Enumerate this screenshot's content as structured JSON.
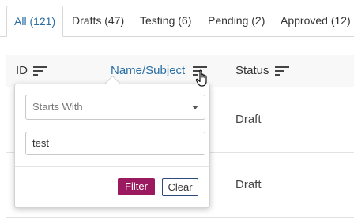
{
  "tabs": [
    {
      "label": "All (121)",
      "active": true
    },
    {
      "label": "Drafts (47)",
      "active": false
    },
    {
      "label": "Testing (6)",
      "active": false
    },
    {
      "label": "Pending (2)",
      "active": false
    },
    {
      "label": "Approved (12)",
      "active": false
    }
  ],
  "table": {
    "columns": [
      {
        "label": "ID",
        "icon": "sort-lines-icon"
      },
      {
        "label": "Name/Subject",
        "icon": "sort-lines-icon",
        "highlighted": true
      },
      {
        "label": "Status",
        "icon": "sort-lines-icon"
      }
    ],
    "rows": [
      {
        "status": "Draft"
      },
      {
        "status": "Draft"
      }
    ]
  },
  "filter_popup": {
    "match_mode": "Starts With",
    "value": "test",
    "filter_label": "Filter",
    "clear_label": "Clear"
  },
  "colors": {
    "accent": "#2b6ea4",
    "filter_button": "#9b1a5f",
    "header_bg": "#f8f8f8"
  }
}
